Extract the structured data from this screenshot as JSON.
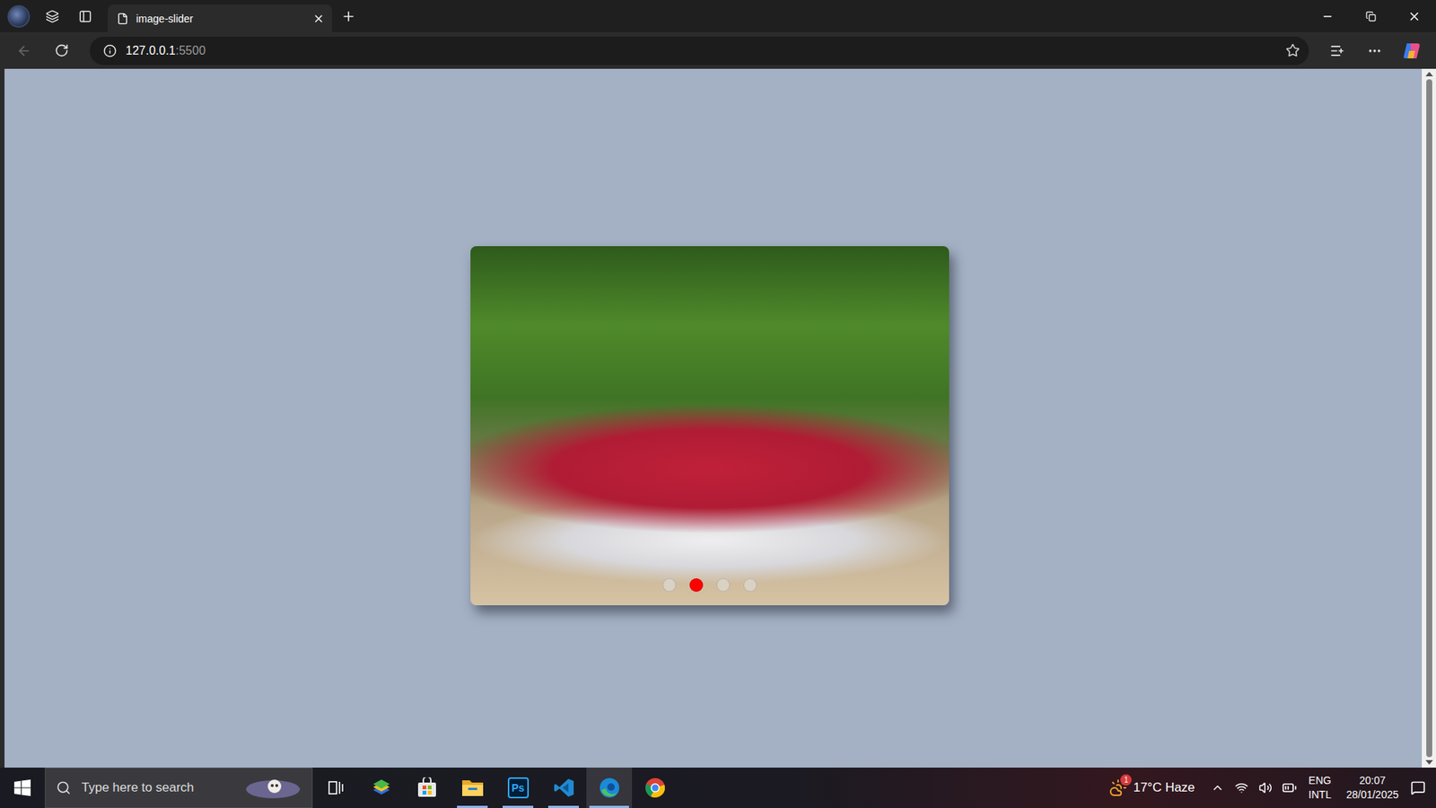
{
  "browser": {
    "tab_title": "image-slider",
    "address": {
      "host": "127.0.0.1",
      "port": ":5500"
    },
    "back_disabled": true
  },
  "slider": {
    "dots": [
      {
        "selected": false
      },
      {
        "selected": true
      },
      {
        "selected": false
      },
      {
        "selected": false
      }
    ]
  },
  "taskbar": {
    "search_placeholder": "Type here to search",
    "apps": [
      {
        "kind": "bluestacks",
        "running": false,
        "focused": false
      },
      {
        "kind": "store",
        "running": false,
        "focused": false
      },
      {
        "kind": "explorer",
        "running": true,
        "focused": false
      },
      {
        "kind": "photoshop",
        "label": "Ps",
        "running": true,
        "focused": false
      },
      {
        "kind": "vscode",
        "running": true,
        "focused": false
      },
      {
        "kind": "edge",
        "running": true,
        "focused": true
      },
      {
        "kind": "chrome",
        "running": false,
        "focused": false
      }
    ],
    "weather": {
      "reading": "17°C Haze",
      "badge": "1"
    },
    "language": [
      "ENG",
      "INTL"
    ],
    "clock": {
      "time": "20:07",
      "date": "28/01/2025"
    }
  }
}
